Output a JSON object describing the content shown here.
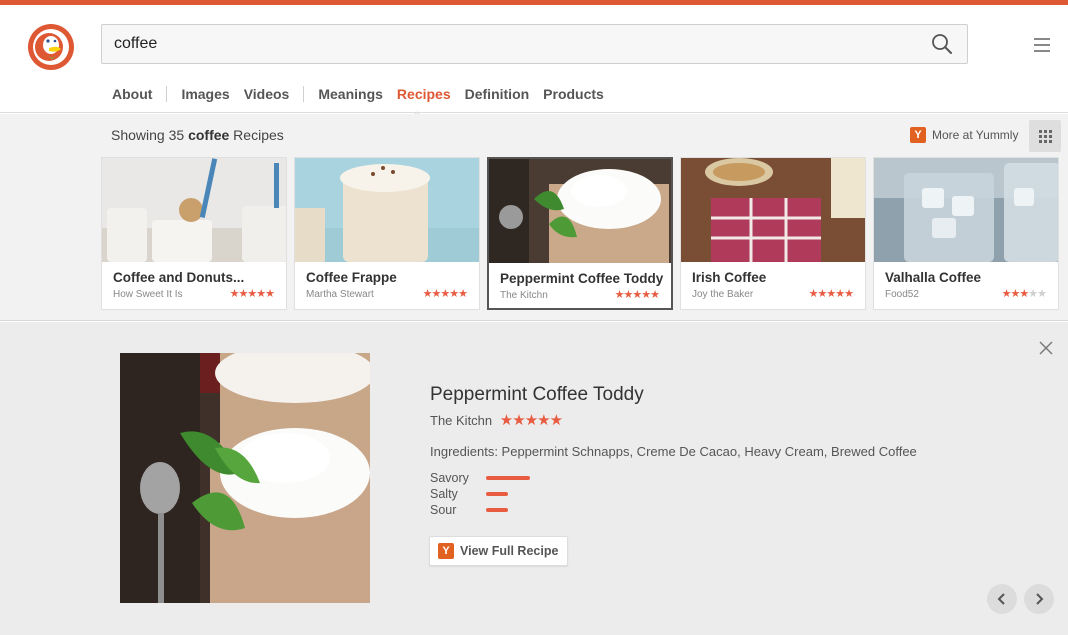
{
  "search": {
    "query": "coffee"
  },
  "nav": {
    "items": [
      "About",
      "Images",
      "Videos",
      "Meanings",
      "Recipes",
      "Definition",
      "Products"
    ],
    "active": "Recipes"
  },
  "results": {
    "showing_prefix": "Showing 35 ",
    "showing_bold": "coffee",
    "showing_suffix": " Recipes",
    "more_label": "More at Yummly"
  },
  "recipes": [
    {
      "title": "Coffee and Donuts...",
      "source": "How Sweet It Is",
      "rating": 5
    },
    {
      "title": "Coffee Frappe",
      "source": "Martha Stewart",
      "rating": 5
    },
    {
      "title": "Peppermint Coffee Toddy",
      "source": "The Kitchn",
      "rating": 5
    },
    {
      "title": "Irish Coffee",
      "source": "Joy the Baker",
      "rating": 5
    },
    {
      "title": "Valhalla Coffee",
      "source": "Food52",
      "rating": 3
    }
  ],
  "detail": {
    "title": "Peppermint Coffee Toddy",
    "source": "The Kitchn",
    "rating": 5,
    "ingredients": "Ingredients: Peppermint Schnapps, Creme De Cacao, Heavy Cream, Brewed Coffee",
    "flavors": [
      {
        "label": "Savory",
        "level": 0.5
      },
      {
        "label": "Salty",
        "level": 0.25
      },
      {
        "label": "Sour",
        "level": 0.25
      }
    ],
    "view_button": "View Full Recipe"
  },
  "colors": {
    "brand": "#de5833",
    "star": "#e85c41",
    "yummly": "#e16120"
  },
  "icons": {
    "yummly": "Y"
  }
}
